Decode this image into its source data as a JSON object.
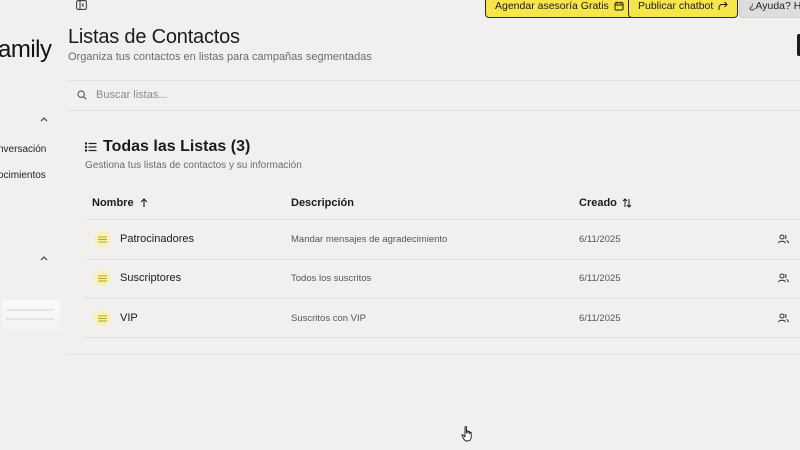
{
  "sidebar": {
    "brand_partial": "amily",
    "items": [
      {
        "label": "nversación"
      },
      {
        "label": "ocimientos"
      }
    ]
  },
  "topbar": {
    "schedule_label": "Agendar asesoría Gratis",
    "publish_label": "Publicar chatbot",
    "help_label": "¿Ayuda? Ha"
  },
  "page": {
    "title": "Listas de Contactos",
    "subtitle": "Organiza tus contactos en listas para campañas segmentadas"
  },
  "search": {
    "placeholder": "Buscar listas..."
  },
  "card": {
    "title": "Todas las Listas (3)",
    "subtitle": "Gestiona tus listas de contactos y su información"
  },
  "table": {
    "columns": {
      "name": "Nombre",
      "description": "Descripción",
      "created": "Creado"
    },
    "rows": [
      {
        "name": "Patrocinadores",
        "description": "Mandar mensajes de agradecimiento",
        "created": "6/11/2025"
      },
      {
        "name": "Suscriptores",
        "description": "Todos los suscritos",
        "created": "6/11/2025"
      },
      {
        "name": "VIP",
        "description": "Suscritos con VIP",
        "created": "6/11/2025"
      }
    ]
  },
  "colors": {
    "accent_yellow": "#f7e64a",
    "background": "#f1f0ee"
  }
}
